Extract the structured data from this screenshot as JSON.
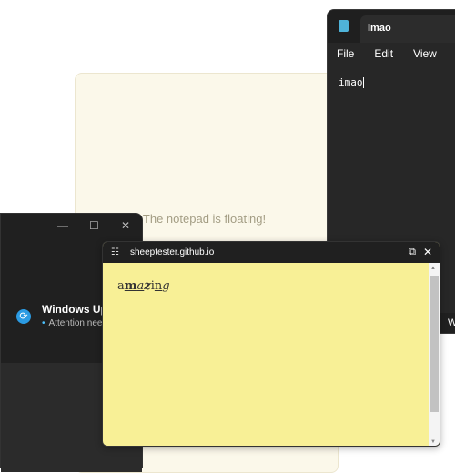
{
  "background_panel": {
    "message": "The notepad is floating!"
  },
  "notepad": {
    "tab_title": "imao",
    "menu": [
      "File",
      "Edit",
      "View"
    ],
    "content": "imao",
    "status": "W"
  },
  "windows_update": {
    "title": "Windows Update",
    "subtitle": "Attention needed",
    "controls": {
      "minimize": "—",
      "maximize": "☐",
      "close": "✕"
    }
  },
  "popup": {
    "title": "sheeptester.github.io",
    "content": {
      "parts": [
        "a",
        "m",
        "a",
        "z",
        "i",
        "n",
        "g"
      ]
    }
  }
}
